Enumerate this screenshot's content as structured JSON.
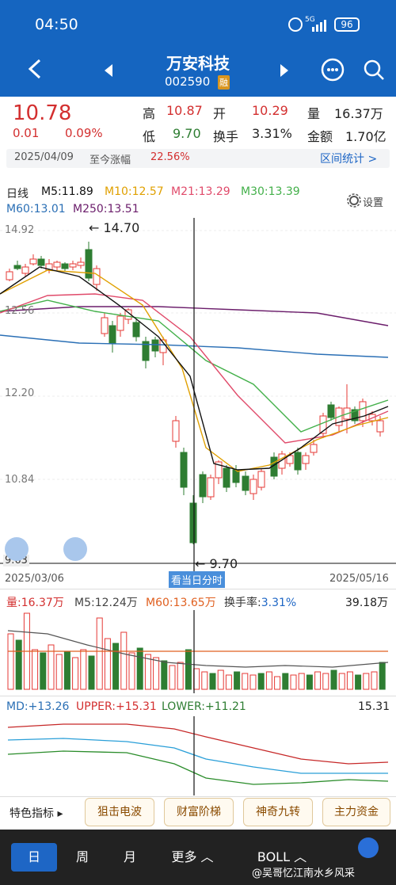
{
  "status": {
    "time": "04:50",
    "network": "5G",
    "battery": "96"
  },
  "nav": {
    "stock_name": "万安科技",
    "stock_code": "002590",
    "margin_badge": "融"
  },
  "quote": {
    "price": "10.78",
    "change": "0.01",
    "change_pct": "0.09%",
    "high_label": "高",
    "high": "10.87",
    "open_label": "开",
    "open": "10.29",
    "volume_label": "量",
    "volume": "16.37万",
    "low_label": "低",
    "low": "9.70",
    "turnover_label": "换手",
    "turnover": "3.31%",
    "amount_label": "金额",
    "amount": "1.70亿",
    "date": "2025/04/09",
    "since_label": "至今涨幅",
    "since_pct": "22.56%",
    "range_stats": "区间统计 >"
  },
  "ma_legend": {
    "period": "日线",
    "ma5": "M5:11.89",
    "ma10": "M10:12.57",
    "ma21": "M21:13.29",
    "ma30": "M30:13.39",
    "ma60": "M60:13.01",
    "ma250": "M250:13.51",
    "settings": "设置"
  },
  "colors": {
    "ma5": "#111111",
    "ma10": "#e0a000",
    "ma21": "#e04a6a",
    "ma30": "#43b04a",
    "ma60": "#2a6fb5",
    "ma250": "#6b1d6b",
    "up": "#e53935",
    "down": "#2e7d32"
  },
  "price_chart": {
    "y_labels": [
      "14.92",
      "12.56",
      "12.20",
      "10.84",
      "9.63"
    ],
    "high_marker": "14.70",
    "low_marker": "9.70",
    "date_start": "2025/03/06",
    "date_end": "2025/05/16",
    "cursor_label": "看当日分时"
  },
  "volume_panel": {
    "vol": "量:16.37万",
    "m5": "M5:12.24万",
    "m60": "M60:13.65万",
    "turnover_label": "换手率:",
    "turnover": "3.31%",
    "max": "39.18万"
  },
  "boll_panel": {
    "md": "MD:+13.26",
    "upper": "UPPER:+15.31",
    "lower": "LOWER:+11.21",
    "max": "15.31"
  },
  "tools": {
    "feature_label": "特色指标 ▸",
    "chips": [
      "狙击电波",
      "财富阶梯",
      "神奇九转",
      "主力资金"
    ]
  },
  "bottom_nav": {
    "tabs": [
      "日",
      "周",
      "月",
      "更多 ︿"
    ],
    "indicator": "BOLL ︿",
    "watermark": "@吴哥忆江南水乡风采"
  },
  "chart_data": {
    "type": "candlestick",
    "x_range": [
      "2025/03/06",
      "2025/05/16"
    ],
    "ylim": [
      9.63,
      14.92
    ],
    "highest": 14.7,
    "lowest": 9.7,
    "last": {
      "close": 10.78,
      "open": 10.29,
      "high": 10.87,
      "low": 9.7
    }
  }
}
